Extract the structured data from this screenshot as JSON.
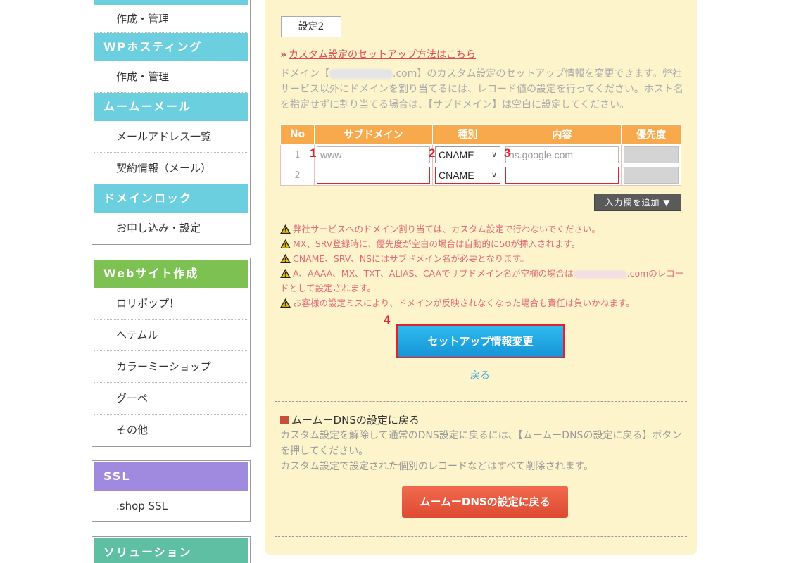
{
  "sidebar": {
    "box1": {
      "items": [
        "作成・管理"
      ],
      "wp_header": "WPホスティング",
      "wp_items": [
        "作成・管理"
      ],
      "mail_header": "ムームーメール",
      "mail_items": [
        "メールアドレス一覧",
        "契約情報（メール）"
      ],
      "lock_header": "ドメインロック",
      "lock_items": [
        "お申し込み・設定"
      ]
    },
    "box2": {
      "header": "Webサイト作成",
      "items": [
        "ロリポップ！",
        "ヘテムル",
        "カラーミーショップ",
        "グーペ",
        "その他"
      ]
    },
    "box3": {
      "header": "SSL",
      "items": [
        ".shop SSL"
      ]
    },
    "box4": {
      "header": "ソリューション"
    },
    "colors": {
      "cyan": "#6bcfe0",
      "green": "#7cc152",
      "purple": "#9f8ae0",
      "teal": "#5fbfa3"
    }
  },
  "main": {
    "tab_label": "設定2",
    "setup_link": "カスタム設定のセットアップ方法はこちら",
    "desc_before": "ドメイン【",
    "desc_after": ".com】のカスタム設定のセットアップ情報を変更できます。弊社サービス以外にドメインを割り当てるには、レコード値の設定を行ってください。ホスト名を指定せずに割り当てる場合は、【サブドメイン】は空白に設定してください。",
    "table": {
      "headers": [
        "No",
        "サブドメイン",
        "種別",
        "内容",
        "優先度"
      ],
      "rows": [
        {
          "no": "1",
          "subdomain": "www",
          "type": "CNAME",
          "content": "hs.google.com",
          "priority": ""
        },
        {
          "no": "2",
          "subdomain": "",
          "type": "CNAME",
          "content": "",
          "priority": ""
        }
      ]
    },
    "steps": {
      "s1": "1",
      "s2": "2",
      "s3": "3",
      "s4": "4"
    },
    "add_row_button": "入力欄を追加",
    "notes": [
      "弊社サービスへのドメイン割り当ては、カスタム設定で行わないでください。",
      "MX、SRV登録時に、優先度が空白の場合は自動的に50が挿入されます。",
      "CNAME、SRV、NSにはサブドメイン名が必要となります。"
    ],
    "note4_before": "A、AAAA、MX、TXT、ALIAS、CAAでサブドメイン名が空欄の場合は",
    "note4_after": ".comのレコードとして設定されます。",
    "note5": "お客様の設定ミスにより、ドメインが反映されなくなった場合も責任は負いかねます。",
    "apply_button": "セットアップ情報変更",
    "back_link": "戻る",
    "section_title": "ムームーDNSの設定に戻る",
    "desc2_lines": [
      "カスタム設定を解除して通常のDNS設定に戻るには、【ムームーDNSの設定に戻る】ボタンを押してください。",
      "カスタム設定で設定された個別のレコードなどはすべて削除されます。"
    ],
    "return_button": "ムームーDNSの設定に戻る"
  },
  "colors": {
    "panel_bg": "#fdf4cc",
    "table_header": "#f7a94b",
    "link": "#e14a55",
    "apply_button": "#1ea4e4",
    "return_button": "#e55a3e",
    "highlight_red": "#e0242f"
  }
}
